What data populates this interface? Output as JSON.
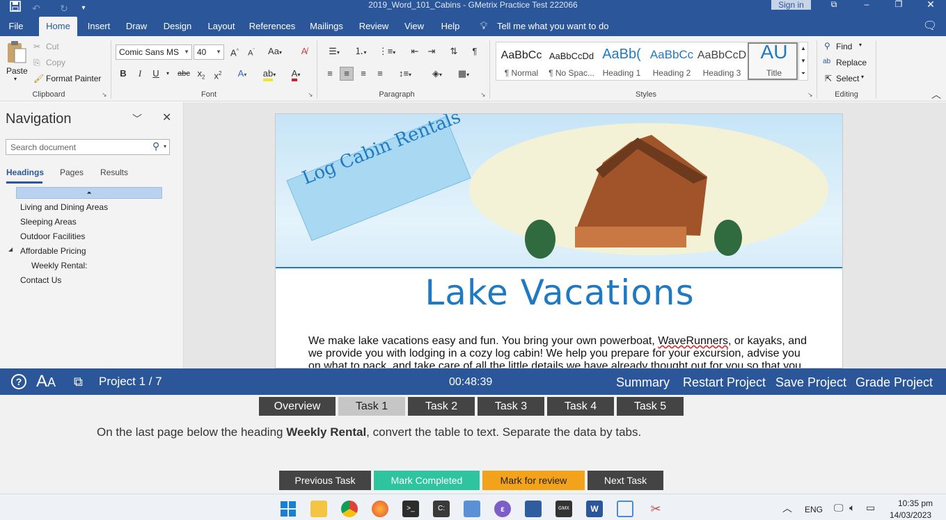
{
  "titlebar": {
    "doc_title": "2019_Word_101_Cabins  -  GMetrix Practice Test 222066",
    "signin": "Sign in"
  },
  "menu": {
    "tabs": [
      "File",
      "Home",
      "Insert",
      "Draw",
      "Design",
      "Layout",
      "References",
      "Mailings",
      "Review",
      "View",
      "Help"
    ],
    "tell_me": "Tell me what you want to do"
  },
  "ribbon": {
    "clipboard": {
      "paste": "Paste",
      "cut": "Cut",
      "copy": "Copy",
      "format_painter": "Format Painter",
      "label": "Clipboard"
    },
    "font": {
      "family": "Comic Sans MS",
      "size": "40",
      "label": "Font"
    },
    "paragraph": {
      "label": "Paragraph"
    },
    "styles": {
      "label": "Styles",
      "items": [
        {
          "sample": "AaBbCc",
          "name": "¶ Normal"
        },
        {
          "sample": "AaBbCcDd",
          "name": "¶ No Spac..."
        },
        {
          "sample": "AaBb(",
          "name": "Heading 1"
        },
        {
          "sample": "AaBbCc",
          "name": "Heading 2"
        },
        {
          "sample": "AaBbCcD",
          "name": "Heading 3"
        },
        {
          "sample": "AU",
          "name": "Title"
        }
      ]
    },
    "editing": {
      "find": "Find",
      "replace": "Replace",
      "select": "Select",
      "label": "Editing"
    }
  },
  "navigation": {
    "title": "Navigation",
    "search_placeholder": "Search document",
    "tabs": [
      "Headings",
      "Pages",
      "Results"
    ],
    "items": [
      {
        "label": "Living and Dining Areas",
        "level": 1
      },
      {
        "label": "Sleeping Areas",
        "level": 1
      },
      {
        "label": "Outdoor Facilities",
        "level": 1
      },
      {
        "label": "Affordable Pricing",
        "level": 1
      },
      {
        "label": "Weekly Rental:",
        "level": 2
      },
      {
        "label": "Contact Us",
        "level": 1
      }
    ]
  },
  "document": {
    "banner_logo": "Log Cabin Rentals",
    "heading": "Lake Vacations",
    "body_line1_a": "We make lake vacations easy and fun. You bring your own powerboat, ",
    "body_line1_b": "WaveRunners",
    "body_line1_c": ", or kayaks, and",
    "body_line2": "we provide you with lodging in a cozy log cabin! We help you prepare for your excursion, advise you",
    "body_line3": "on what to pack, and take care of all the little details we have already thought out for you so that you"
  },
  "gmetrix": {
    "project": "Project 1 / 7",
    "timer": "00:48:39",
    "links": [
      "Summary",
      "Restart Project",
      "Save Project",
      "Grade Project"
    ],
    "tabs": [
      "Overview",
      "Task 1",
      "Task 2",
      "Task 3",
      "Task 4",
      "Task 5"
    ],
    "instruction_a": "On the last page below the heading ",
    "instruction_b": "Weekly Rental",
    "instruction_c": ", convert the table to text. Separate the data by tabs.",
    "buttons": {
      "previous": "Previous Task",
      "mark_completed": "Mark Completed",
      "mark_review": "Mark for review",
      "next": "Next Task"
    }
  },
  "taskbar": {
    "language": "ENG",
    "time": "10:35 pm",
    "date": "14/03/2023"
  },
  "colors": {
    "word_blue": "#2b579a",
    "heading_blue": "#1f7ac2",
    "green_button": "#2ec4a0",
    "orange_button": "#f2a21b",
    "dark_button": "#444444"
  }
}
